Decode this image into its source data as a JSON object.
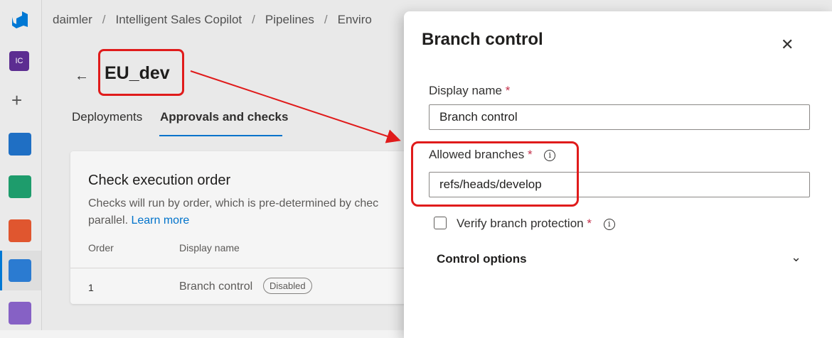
{
  "breadcrumb": {
    "items": [
      "daimler",
      "Intelligent Sales Copilot",
      "Pipelines",
      "Enviro"
    ],
    "separator": "/"
  },
  "rail": {
    "project_badge": "IC"
  },
  "page": {
    "title": "EU_dev",
    "tabs": [
      "Deployments",
      "Approvals and checks"
    ],
    "selected_tab": "Approvals and checks"
  },
  "card": {
    "title": "Check execution order",
    "description": "Checks will run by order, which is pre-determined by chec",
    "description2": "parallel.",
    "learn_more": "Learn more",
    "columns": [
      "Order",
      "Display name"
    ],
    "rows": [
      {
        "order": "1",
        "name": "Branch control",
        "status": "Disabled"
      }
    ]
  },
  "panel": {
    "title": "Branch control",
    "display_name_label": "Display name",
    "display_name_value": "Branch control",
    "allowed_branches_label": "Allowed branches",
    "allowed_branches_value": "refs/heads/develop",
    "verify_label": "Verify branch protection",
    "verify_checked": false,
    "control_options_label": "Control options",
    "required_mark": "*",
    "info_glyph": "i",
    "close_glyph": "✕",
    "chevron_glyph": "⌄"
  },
  "colors": {
    "accent": "#0078d4",
    "annotation": "#e01b1b",
    "required": "#c4314b"
  }
}
